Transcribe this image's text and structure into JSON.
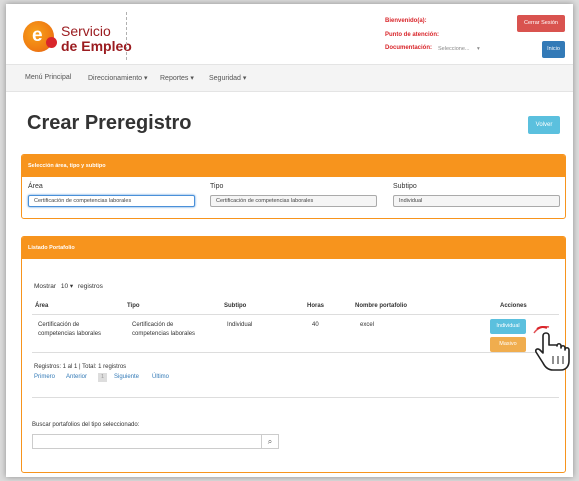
{
  "header": {
    "logo_line1": "Servicio",
    "logo_line2": "de Empleo",
    "bienvenido_label": "Bienvenido(a):",
    "punto_label": "Punto de atención:",
    "documentacion_label": "Documentación:",
    "documentacion_value": "Seleccione...",
    "cerrar_label": "Cerrar Sesión",
    "inicio_label": "Inicio"
  },
  "nav": {
    "items": [
      "Menú Principal",
      "Direccionamiento",
      "Reportes",
      "Seguridad"
    ]
  },
  "page": {
    "title": "Crear Preregistro",
    "volver_label": "Volver"
  },
  "seleccion": {
    "heading": "Selección área, tipo y subtipo",
    "area_label": "Área",
    "area_value": "Certificación de competencias laborales",
    "tipo_label": "Tipo",
    "tipo_value": "Certificación de competencias laborales",
    "subtipo_label": "Subtipo",
    "subtipo_value": "Individual"
  },
  "listado": {
    "heading": "Listado Portafolio",
    "mostrar_label": "Mostrar",
    "mostrar_value": "10",
    "registros_label": "registros",
    "columns": [
      "Área",
      "Tipo",
      "Subtipo",
      "Horas",
      "Nombre portafolio",
      "Acciones"
    ],
    "rows": [
      {
        "area_line1": "Certificación de",
        "area_line2": "competencias laborales",
        "tipo_line1": "Certificación de",
        "tipo_line2": "competencias laborales",
        "subtipo": "Individual",
        "horas": "40",
        "nombre": "excel",
        "btn_individual": "Individual",
        "btn_masivo": "Masivo"
      }
    ],
    "summary": "Registros: 1 al 1 | Total: 1 registros",
    "pagination": {
      "first": "Primero",
      "prev": "Anterior",
      "current": "1",
      "next": "Siguiente",
      "last": "Último"
    },
    "buscar_label": "Buscar portafolios del tipo seleccionado:",
    "buscar_value": ""
  },
  "colors": {
    "accent_orange": "#f7941d",
    "info_blue": "#5bc0de",
    "danger_red": "#d9534f",
    "primary_blue": "#337ab7",
    "warning_orange": "#f0ad4e",
    "brand_red": "#9b1c20"
  },
  "icons": [
    "search-icon",
    "hand-cursor-icon",
    "caret-down-icon"
  ]
}
